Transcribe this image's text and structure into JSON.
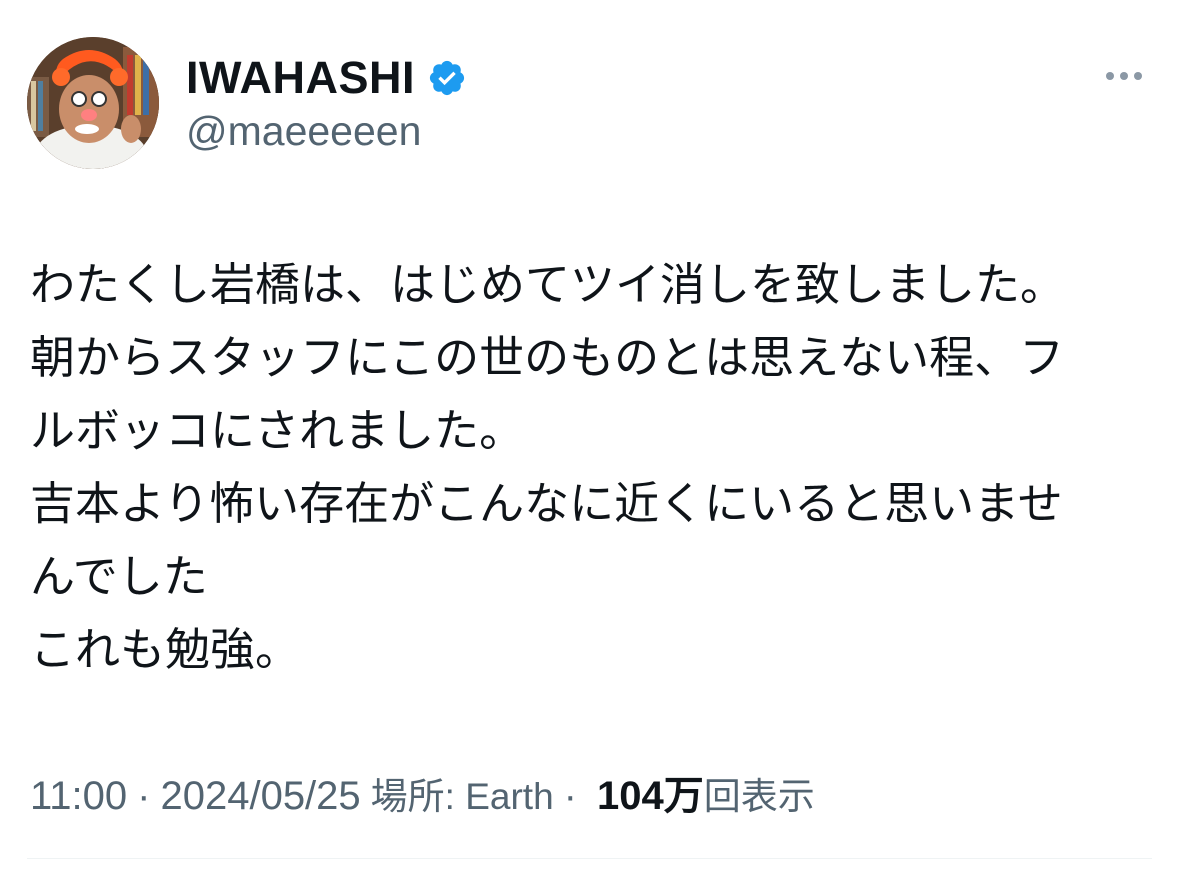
{
  "author": {
    "display_name": "IWAHASHI",
    "handle": "@maeeeeen",
    "verified": true,
    "avatar_icon": "profile-photo",
    "verified_icon": "verified-badge-icon"
  },
  "colors": {
    "primary_text": "#0f1419",
    "secondary_text": "#536471",
    "verified_badge": "#1d9bf0",
    "divider": "#eff3f4"
  },
  "more_icon": "more-horizontal-icon",
  "tweet": {
    "lines": [
      "わたくし岩橋は、はじめてツイ消しを致しました。",
      "朝からスタッフにこの世のものとは思えない程、フ",
      "ルボッコにされました。",
      "吉本より怖い存在がこんなに近くにいると思いませ",
      "んでした",
      "これも勉強。"
    ]
  },
  "meta": {
    "time": "11:00",
    "date": "2024/05/25",
    "location_label": "場所: Earth",
    "separator": "·",
    "views_count": "104万",
    "views_label": "回表示"
  }
}
